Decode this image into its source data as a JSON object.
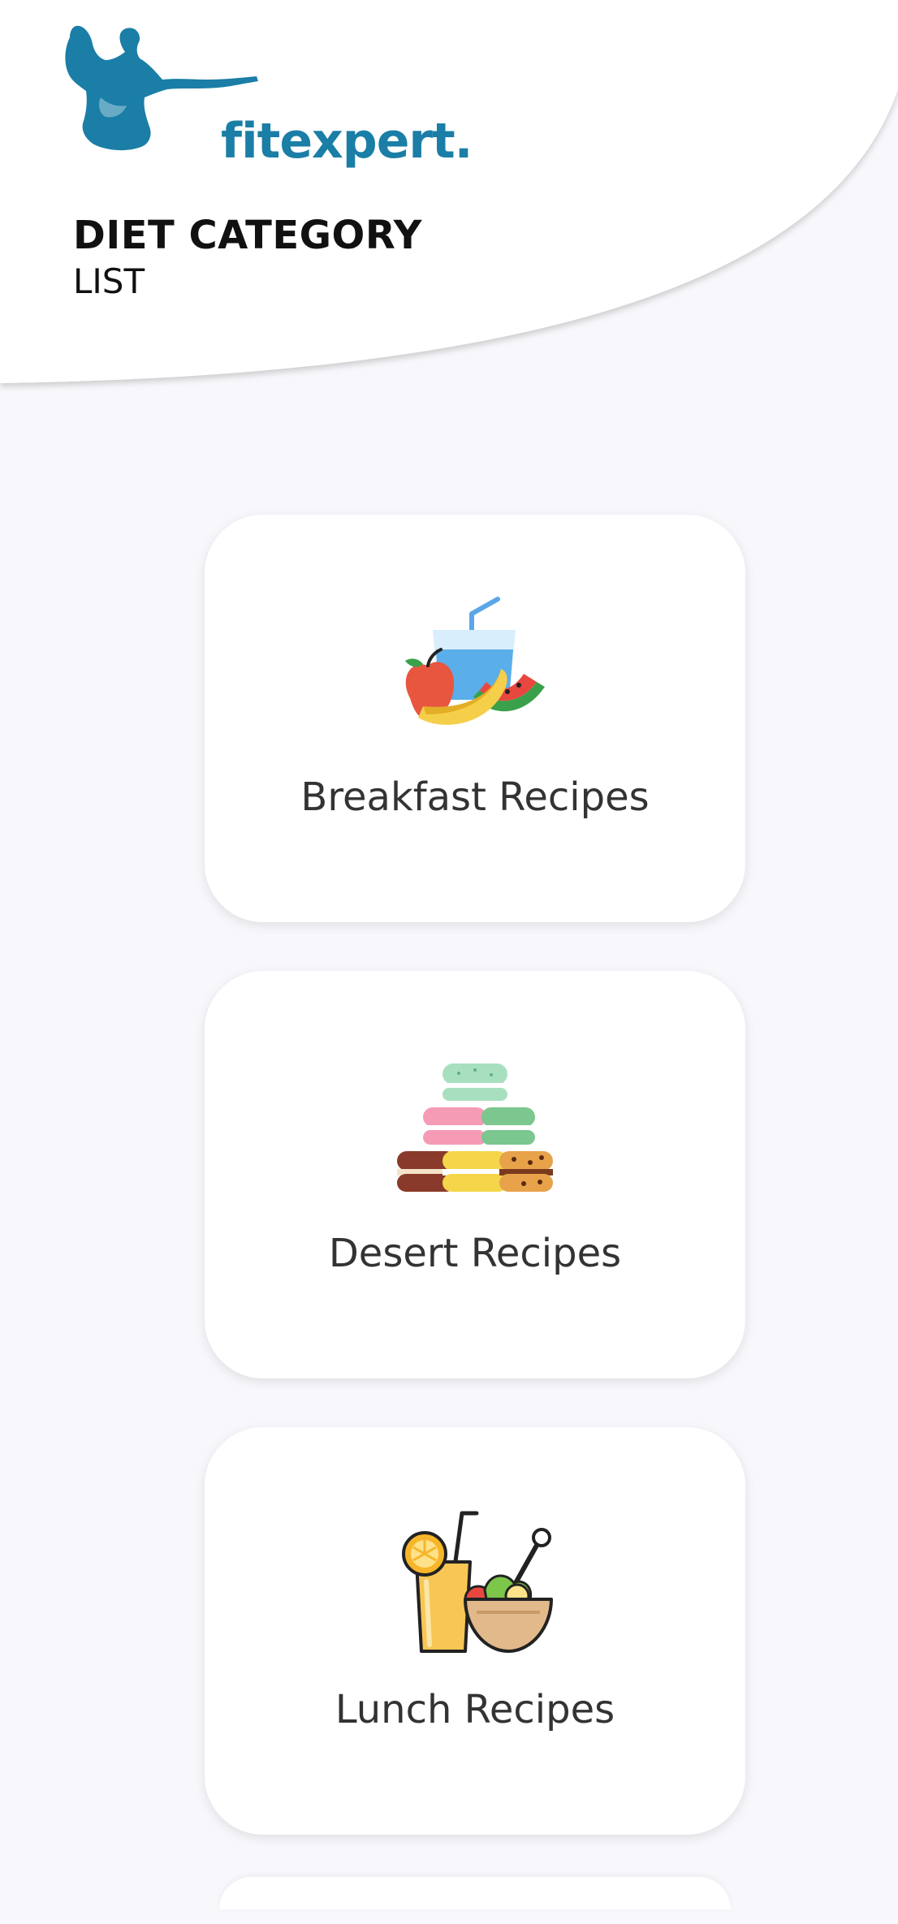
{
  "app": {
    "logo_text": "fitexpert.",
    "brand_color": "#1a7ea6"
  },
  "header": {
    "title": "DIET CATEGORY",
    "subtitle": "LIST"
  },
  "categories": [
    {
      "label": "Breakfast Recipes",
      "icon": "breakfast-fruit-icon"
    },
    {
      "label": "Desert Recipes",
      "icon": "macaron-stack-icon"
    },
    {
      "label": "Lunch Recipes",
      "icon": "lunch-bowl-icon"
    }
  ]
}
